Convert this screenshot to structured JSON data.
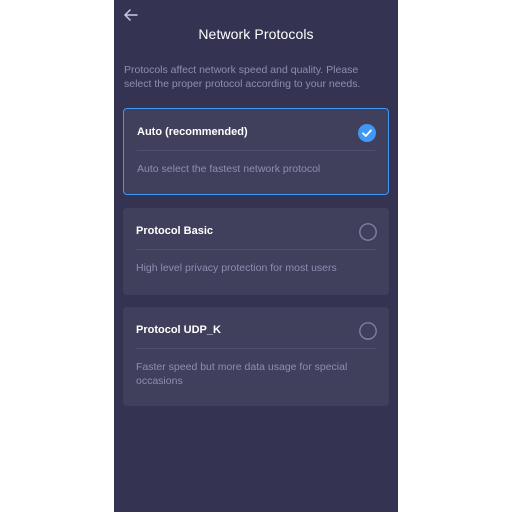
{
  "header": {
    "title": "Network Protocols",
    "back_icon": "arrow-left-icon"
  },
  "description": "Protocols affect network speed and quality. Please select the proper protocol according to your needs.",
  "colors": {
    "background": "#343452",
    "card": "#40405d",
    "accent": "#3f97f6",
    "muted_text": "#8c8fb0"
  },
  "protocols": [
    {
      "name": "Auto (recommended)",
      "description": "Auto select the fastest network protocol",
      "selected": true
    },
    {
      "name": "Protocol Basic",
      "description": "High level privacy protection for most users",
      "selected": false
    },
    {
      "name": "Protocol UDP_K",
      "description": "Faster speed but more data usage for special occasions",
      "selected": false
    }
  ]
}
